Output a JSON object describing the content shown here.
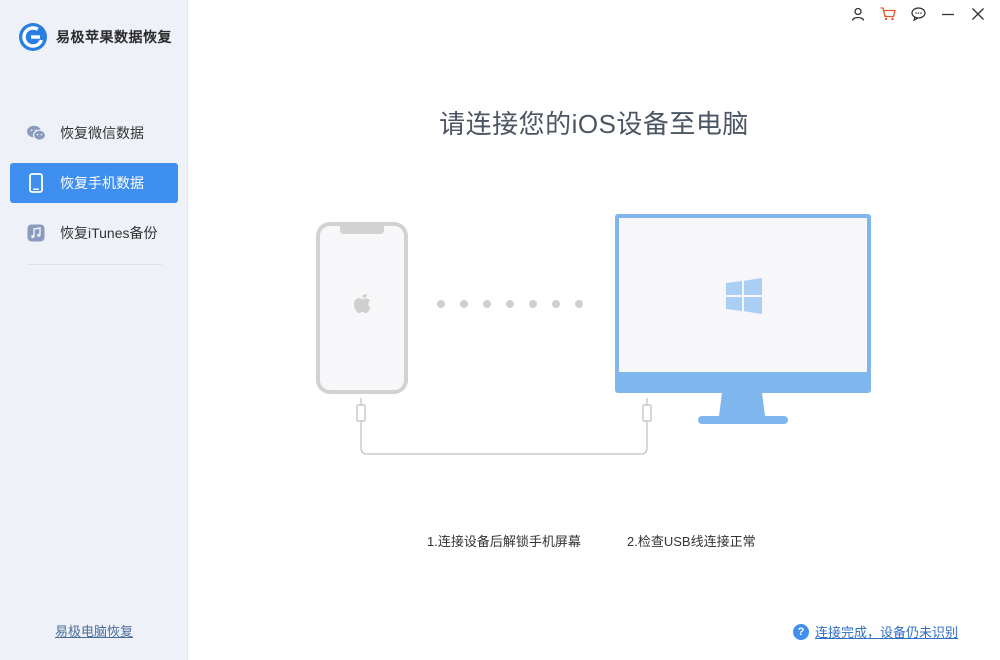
{
  "app": {
    "name": "易极苹果数据恢复",
    "logo_icon": "circular-e-logo-icon"
  },
  "sidebar": {
    "items": [
      {
        "label": "恢复微信数据",
        "icon": "wechat-icon",
        "active": false
      },
      {
        "label": "恢复手机数据",
        "icon": "phone-icon",
        "active": true
      },
      {
        "label": "恢复iTunes备份",
        "icon": "itunes-music-icon",
        "active": false
      }
    ],
    "footer_link": "易极电脑恢复"
  },
  "titlebar": {
    "icons": [
      "user-icon",
      "cart-icon",
      "chat-icon",
      "minimize-icon",
      "close-icon"
    ]
  },
  "main": {
    "title": "请连接您的iOS设备至电脑",
    "steps": [
      "1.连接设备后解锁手机屏幕",
      "2.检查USB线连接正常"
    ],
    "help_link": "连接完成，设备仍未识别",
    "help_icon_glyph": "?"
  },
  "colors": {
    "accent": "#3f8ff0",
    "sidebar_bg": "#eef1f7",
    "monitor_frame": "#7fb6ee",
    "phone_frame": "#d2d2d2",
    "cart_icon": "#e8532b"
  }
}
